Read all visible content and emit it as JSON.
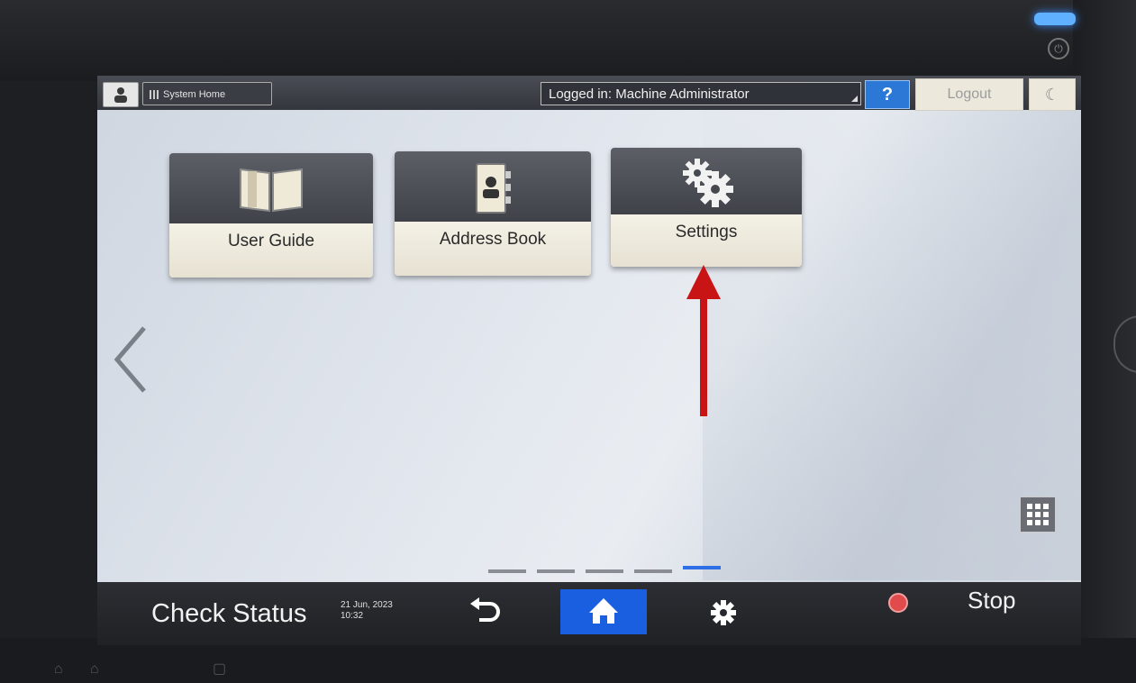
{
  "topbar": {
    "system_home": "System Home",
    "logged_in": "Logged in: Machine Administrator",
    "help": "?",
    "logout": "Logout"
  },
  "tiles": [
    {
      "label": "User Guide",
      "icon": "book-icon"
    },
    {
      "label": "Address Book",
      "icon": "address-book-icon"
    },
    {
      "label": "Settings",
      "icon": "gears-icon"
    }
  ],
  "page_indicator": {
    "total": 5,
    "active": 5
  },
  "bottombar": {
    "check_status": "Check Status",
    "date": "21 Jun, 2023",
    "time": "10:32",
    "stop": "Stop"
  },
  "colors": {
    "accent": "#1a5fe0",
    "help": "#2b78d6",
    "annotation_arrow": "#c81414"
  }
}
